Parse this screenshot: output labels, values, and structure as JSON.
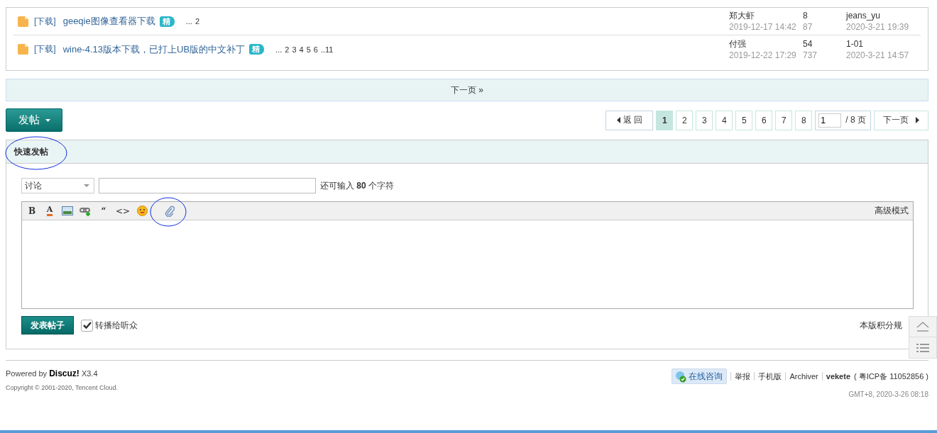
{
  "threads": [
    {
      "tag": "[下载]",
      "title": "geeqie图像查看器下载",
      "badge": "精",
      "pages": [
        "...",
        "2"
      ],
      "author": "郑大虾",
      "created": "2019-12-17 14:42",
      "replies": "8",
      "views": "87",
      "last_poster": "jeans_yu",
      "last_time": "2020-3-21 19:39"
    },
    {
      "tag": "[下载]",
      "title": "wine-4.13版本下载，已打上UB版的中文补丁",
      "badge": "精",
      "pages": [
        "...",
        "2",
        "3",
        "4",
        "5",
        "6",
        "..11"
      ],
      "author": "付强",
      "created": "2019-12-22 17:29",
      "replies": "54",
      "views": "737",
      "last_poster": "1-01",
      "last_time": "2020-3-21 14:57"
    }
  ],
  "next_bar": "下一页 »",
  "post_button": "发帖",
  "pagination": {
    "back": "返 回",
    "pages": [
      {
        "label": "1",
        "selected": true
      },
      {
        "label": "2",
        "selected": false
      },
      {
        "label": "3",
        "selected": false
      },
      {
        "label": "4",
        "selected": false
      },
      {
        "label": "5",
        "selected": false
      },
      {
        "label": "6",
        "selected": false
      },
      {
        "label": "7",
        "selected": false
      },
      {
        "label": "8",
        "selected": false
      }
    ],
    "jump_value": "1",
    "total": "/ 8 页",
    "next": "下一页"
  },
  "quick_post": {
    "title": "快速发帖",
    "title_circled": true,
    "category": "讨论",
    "remaining": "还可输入 **80** 个字符",
    "toolbar": [
      {
        "kind": "bold",
        "glyph": "B",
        "circled": false
      },
      {
        "kind": "color",
        "glyph": "A",
        "circled": false
      },
      {
        "kind": "image",
        "circled": false
      },
      {
        "kind": "link",
        "circled": false
      },
      {
        "kind": "quote",
        "glyph": "“",
        "circled": false
      },
      {
        "kind": "code",
        "glyph": "<>",
        "circled": false
      },
      {
        "kind": "emoji",
        "circled": false
      },
      {
        "kind": "attach",
        "circled": true
      }
    ],
    "advanced": "高级模式",
    "submit": "发表帖子",
    "broadcast": {
      "label": "转播给听众",
      "checked": true
    },
    "rules": "本版积分规"
  },
  "footer": {
    "powered": "Powered by",
    "brand": "Discuz!",
    "version": "X3.4",
    "copyright": "Copyright © 2001-2020, Tencent Cloud.",
    "consult": "在线咨询",
    "links": [
      "举报",
      "手机版",
      "Archiver"
    ],
    "site": "vekete",
    "icp": "( 粤ICP备 11052856 )",
    "time": "GMT+8, 2020-3-26 08:18"
  }
}
